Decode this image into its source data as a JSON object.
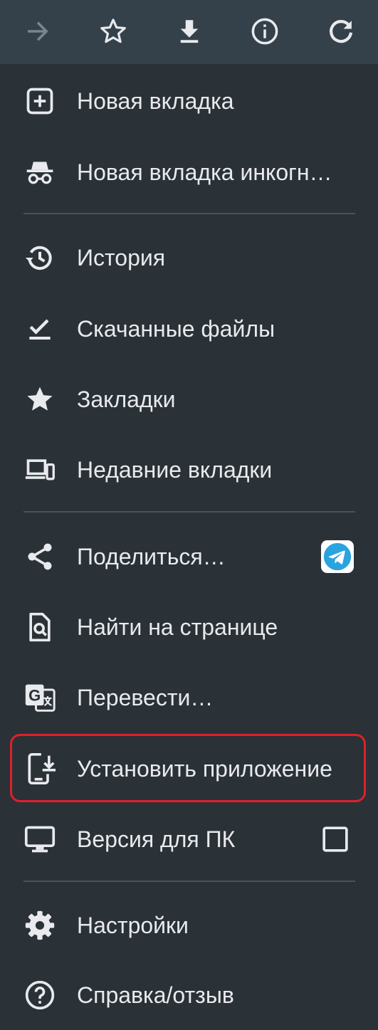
{
  "toolbar": {
    "buttons": [
      "forward-icon",
      "star-icon",
      "download-icon",
      "info-icon",
      "refresh-icon"
    ]
  },
  "menu": {
    "new_tab": "Новая вкладка",
    "incognito_tab": "Новая вкладка инкогн…",
    "history": "История",
    "downloads": "Скачанные файлы",
    "bookmarks": "Закладки",
    "recent_tabs": "Недавние вкладки",
    "share": "Поделиться…",
    "find_in_page": "Найти на странице",
    "translate": "Перевести…",
    "install_app": "Установить приложение",
    "desktop_site": "Версия для ПК",
    "settings": "Настройки",
    "help": "Справка/отзыв"
  },
  "share_target_icon": "telegram-icon",
  "desktop_site_checked": false,
  "colors": {
    "background": "#2a3137",
    "toolbar": "#35414a",
    "highlight": "#e0202a",
    "telegram": "#2aa3df"
  }
}
